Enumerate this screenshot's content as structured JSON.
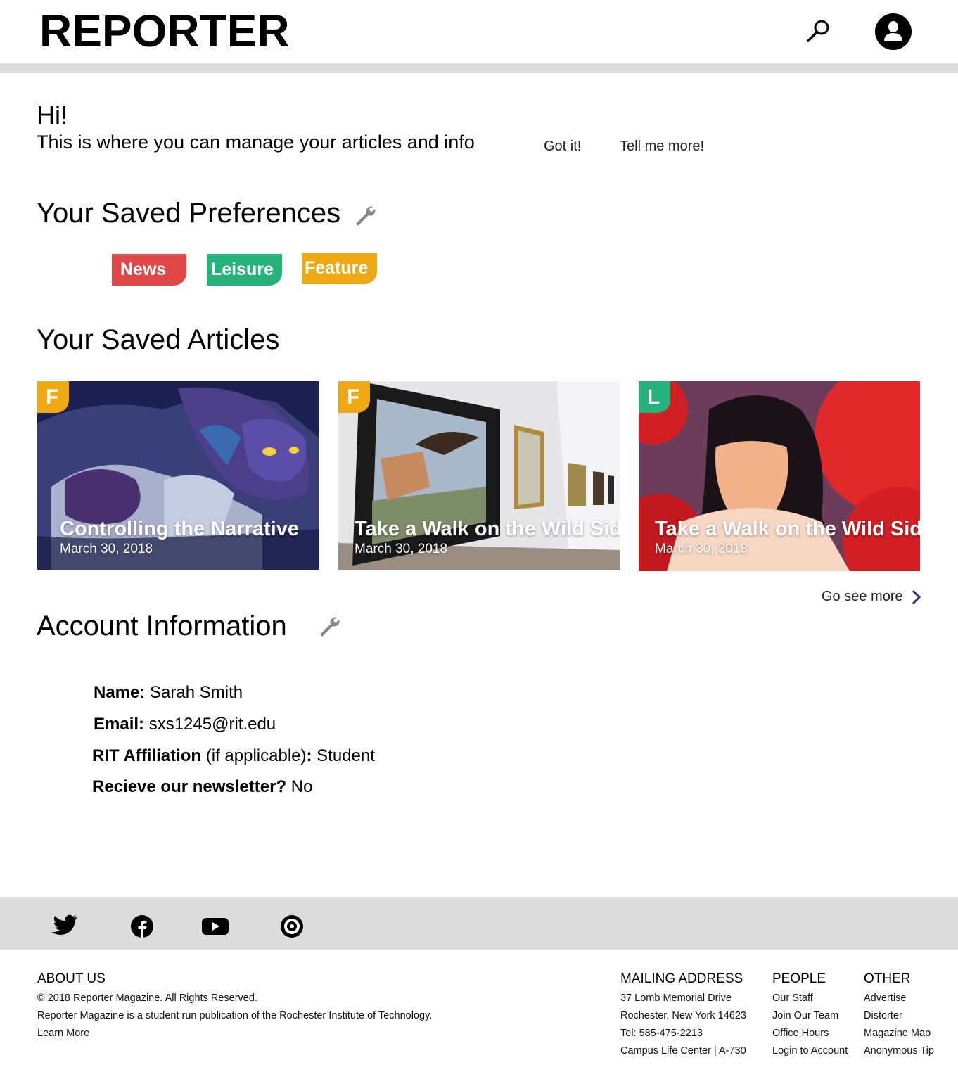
{
  "header": {
    "logo": "REPORTER",
    "search_icon": "search-icon",
    "account_icon": "user-account-icon"
  },
  "welcome": {
    "greeting": "Hi!",
    "message": "This is where you can manage your articles and info",
    "got_it": "Got it!",
    "tell_me_more": "Tell me more!"
  },
  "preferences": {
    "title": "Your Saved Preferences",
    "edit_icon": "wrench-icon",
    "tags": [
      {
        "label": "News",
        "color": "#e04848"
      },
      {
        "label": "Leisure",
        "color": "#25b37b"
      },
      {
        "label": "Feature",
        "color": "#efa915"
      }
    ]
  },
  "articles": {
    "title": "Your Saved Articles",
    "items": [
      {
        "badge": "F",
        "title": "Controlling the Narrative",
        "date": "March 30, 2018"
      },
      {
        "badge": "F",
        "title": "Take a Walk on the Wild Side",
        "date": "March 30, 2018"
      },
      {
        "badge": "L",
        "title": "Take a Walk on the Wild Side",
        "date": "March 30, 2018"
      }
    ],
    "see_more": "Go see more"
  },
  "account": {
    "title": "Account Information",
    "edit_icon": "wrench-icon",
    "name_label": "Name:",
    "name_value": " Sarah Smith",
    "email_label": "Email:",
    "email_value": " sxs1245@rit.edu",
    "affiliation_label": "RIT Affiliation",
    "affiliation_note": " (if applicable)",
    "affiliation_colon": ":",
    "affiliation_value": " Student",
    "newsletter_label": "Recieve our newsletter?",
    "newsletter_value": " No"
  },
  "social": [
    "twitter-icon",
    "facebook-icon",
    "youtube-icon",
    "issuu-icon"
  ],
  "footer": {
    "about": {
      "heading": "ABOUT US",
      "copyright": "© 2018 Reporter Magazine. All Rights Reserved.",
      "description": "Reporter Magazine is a student run publication of the Rochester Institute of Technology.",
      "learn_more": "Learn More"
    },
    "mailing": {
      "heading": "MAILING ADDRESS",
      "lines": [
        "37 Lomb Memorial Drive",
        "Rochester, New York 14623",
        "Tel: 585-475-2213",
        "Campus Life Center | A-730"
      ]
    },
    "people": {
      "heading": "PEOPLE",
      "links": [
        "Our Staff",
        "Join Our Team",
        "Office Hours",
        "Login to Account"
      ]
    },
    "other": {
      "heading": "OTHER",
      "links": [
        "Advertise",
        "Distorter",
        "Magazine Map",
        "Anonymous Tip"
      ]
    }
  }
}
